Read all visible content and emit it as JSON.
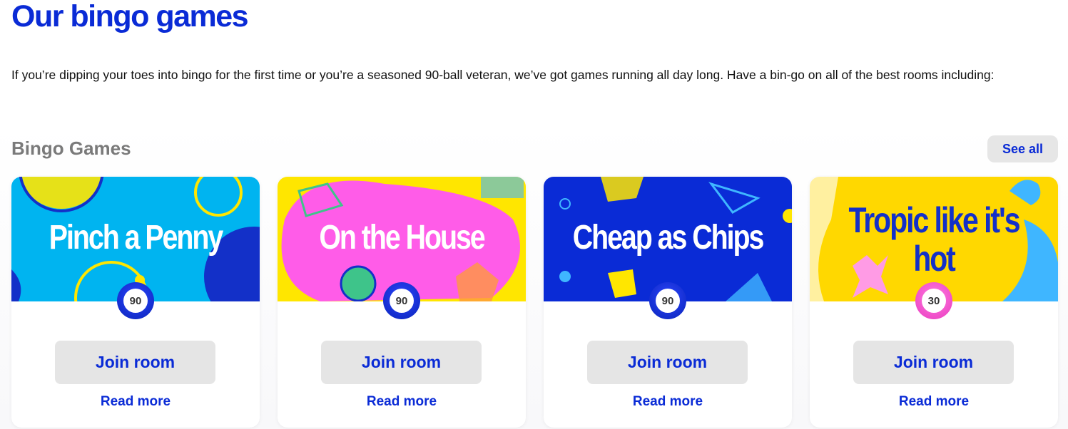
{
  "page": {
    "title": "Our bingo games",
    "intro": "If you’re dipping your toes into bingo for the first time or you’re a seasoned 90-ball veteran, we’ve got games running all day long. Have a bin-go on all of the best rooms including:"
  },
  "section": {
    "title": "Bingo Games",
    "see_all_label": "See all"
  },
  "cards": [
    {
      "banner_title": "Pinch a Penny",
      "ball": "90",
      "join_label": "Join room",
      "read_more_label": "Read more",
      "banner_color": "#00b4f0",
      "ball_color": "blue"
    },
    {
      "banner_title": "On the House",
      "ball": "90",
      "join_label": "Join room",
      "read_more_label": "Read more",
      "banner_color": "#ff5ce8",
      "ball_color": "blue"
    },
    {
      "banner_title": "Cheap as Chips",
      "ball": "90",
      "join_label": "Join room",
      "read_more_label": "Read more",
      "banner_color": "#0a2bd6",
      "ball_color": "blue"
    },
    {
      "banner_title": "Tropic like it's hot",
      "ball": "30",
      "join_label": "Join room",
      "read_more_label": "Read more",
      "banner_color": "#ffd800",
      "ball_color": "pink"
    }
  ],
  "colors": {
    "brand_blue": "#0a2bd6",
    "button_grey": "#e5e5e5",
    "section_title_grey": "#7a7a7a"
  }
}
